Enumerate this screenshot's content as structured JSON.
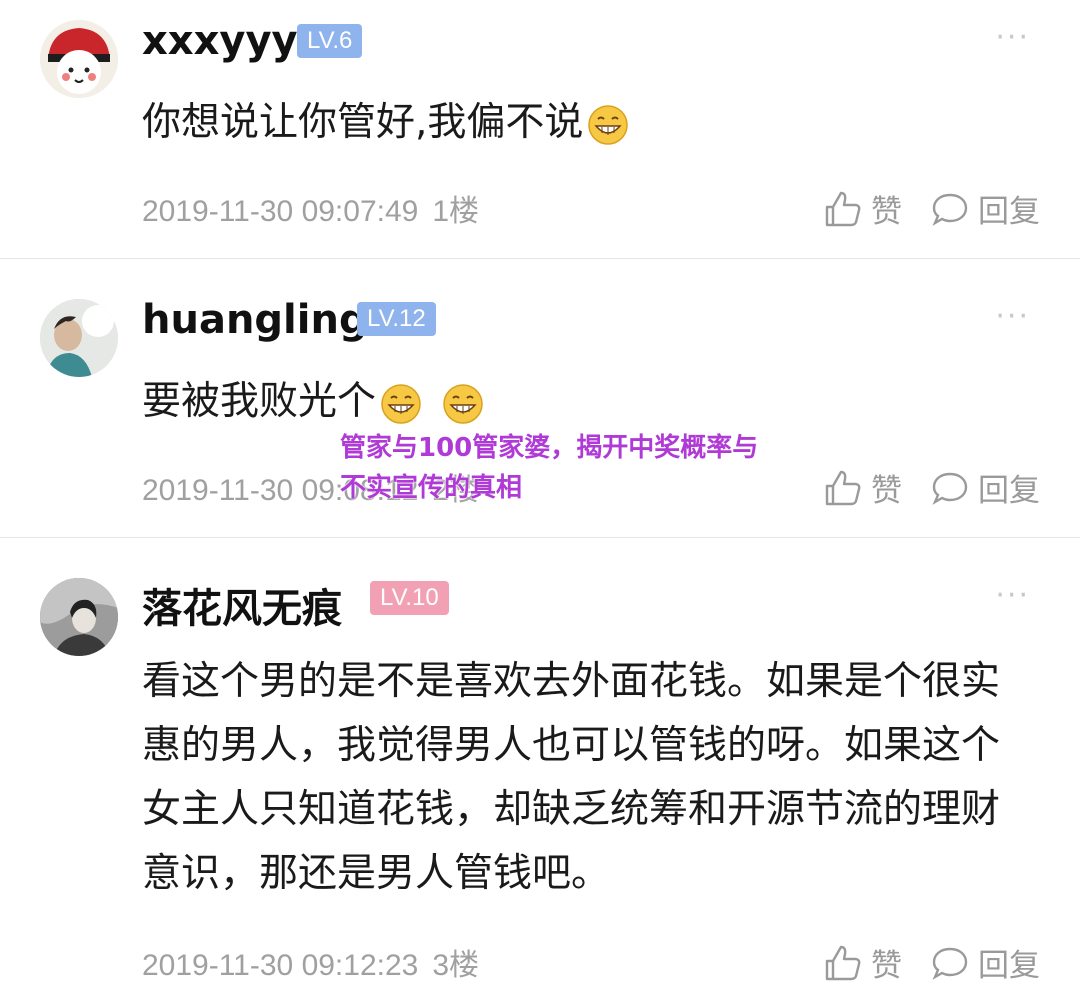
{
  "comments": [
    {
      "username": "xxxyyy",
      "level": "LV.6",
      "level_color": "#8fb3ec",
      "content": "你想说让你管好,我偏不说",
      "emoji": [
        "grin-emoji"
      ],
      "time": "2019-11-30 09:07:49",
      "floor": "1楼",
      "like_label": "赞",
      "reply_label": "回复",
      "more": "···"
    },
    {
      "username": "huangling",
      "level": "LV.12",
      "level_color": "#8fb3ec",
      "content": "要被我败光个",
      "emoji": [
        "grin-emoji",
        "grin-emoji"
      ],
      "time": "2019-11-30 09:08:12",
      "floor": "2楼",
      "like_label": "赞",
      "reply_label": "回复",
      "more": "···"
    },
    {
      "username": "落花风无痕",
      "level": "LV.10",
      "level_color": "#f2a0b4",
      "content": "看这个男的是不是喜欢去外面花钱。如果是个很实惠的男人，我觉得男人也可以管钱的呀。如果这个女主人只知道花钱，却缺乏统筹和开源节流的理财意识，那还是男人管钱吧。",
      "emoji": [],
      "time": "2019-11-30 09:12:23",
      "floor": "3楼",
      "like_label": "赞",
      "reply_label": "回复",
      "more": "···"
    }
  ],
  "overlay_text": "管家与100管家婆，揭开中奖概率与不实宣传的真相",
  "colors": {
    "level_blue": "#8fb3ec",
    "level_pink": "#f2a0b4",
    "overlay": "#b03ad6"
  }
}
